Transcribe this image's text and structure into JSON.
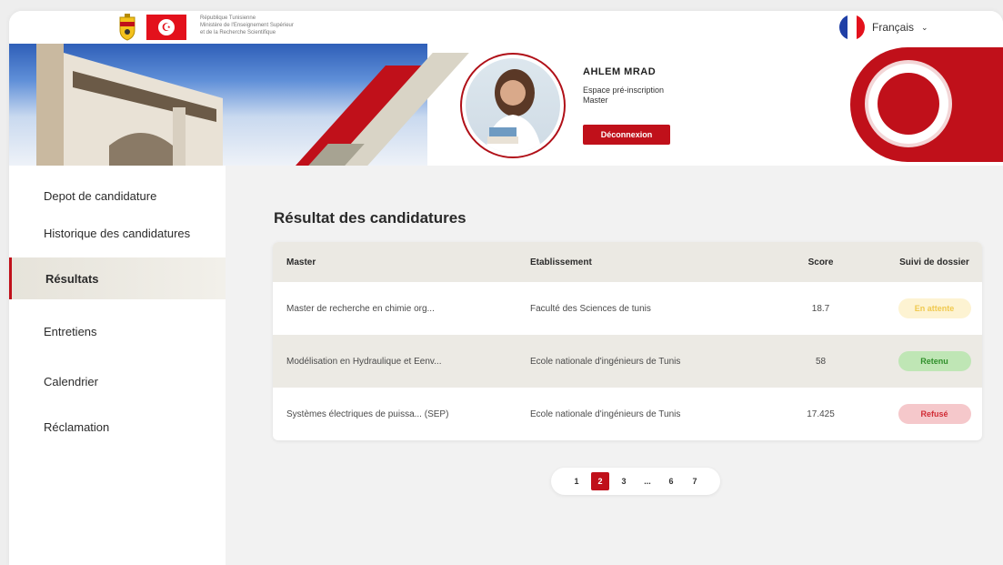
{
  "header": {
    "ministry_lines": [
      "République Tunisienne",
      "Ministère de l'Enseignement Supérieur",
      "et de la Recherche Scientifique"
    ],
    "language": {
      "label": "Français",
      "flag_icon": "france-flag-icon",
      "chevron_icon": "chevron-down-icon"
    }
  },
  "profile": {
    "name": "AHLEM  MRAD",
    "space": "Espace pré-inscription",
    "level": "Master",
    "logout_label": "Déconnexion"
  },
  "sidebar": {
    "items": [
      {
        "label": "Depot de candidature",
        "active": false
      },
      {
        "label": "Historique des candidatures",
        "active": false
      },
      {
        "label": "Résultats",
        "active": true
      },
      {
        "label": "Entretiens",
        "active": false
      },
      {
        "label": "Calendrier",
        "active": false
      },
      {
        "label": "Réclamation",
        "active": false
      }
    ]
  },
  "main": {
    "title": "Résultat des candidatures",
    "table": {
      "headers": [
        "Master",
        "Etablissement",
        "Score",
        "Suivi de dossier"
      ],
      "rows": [
        {
          "master": "Master de recherche en chimie org...",
          "etablissement": "Faculté des Sciences de tunis",
          "score": "18.7",
          "status": "En attente",
          "status_bg": "#fdf3d2",
          "status_fg": "#f0c94e"
        },
        {
          "master": "Modélisation en Hydraulique et Eenv...",
          "etablissement": "Ecole nationale d'ingénieurs de Tunis",
          "score": "58",
          "status": "Retenu",
          "status_bg": "#bfe6b5",
          "status_fg": "#2f8f2a"
        },
        {
          "master": "Systèmes électriques de puissa... (SEP)",
          "etablissement": "Ecole nationale d'ingénieurs de Tunis",
          "score": "17.425",
          "status": "Refusé",
          "status_bg": "#f5c8cb",
          "status_fg": "#d12b35"
        }
      ]
    },
    "pagination": {
      "pages": [
        "1",
        "2",
        "3",
        "...",
        "6",
        "7"
      ],
      "current": "2"
    }
  },
  "colors": {
    "accent": "#c0101a",
    "sidebar_active_bg": "#e6e3da",
    "main_bg": "#f2f2f2"
  }
}
